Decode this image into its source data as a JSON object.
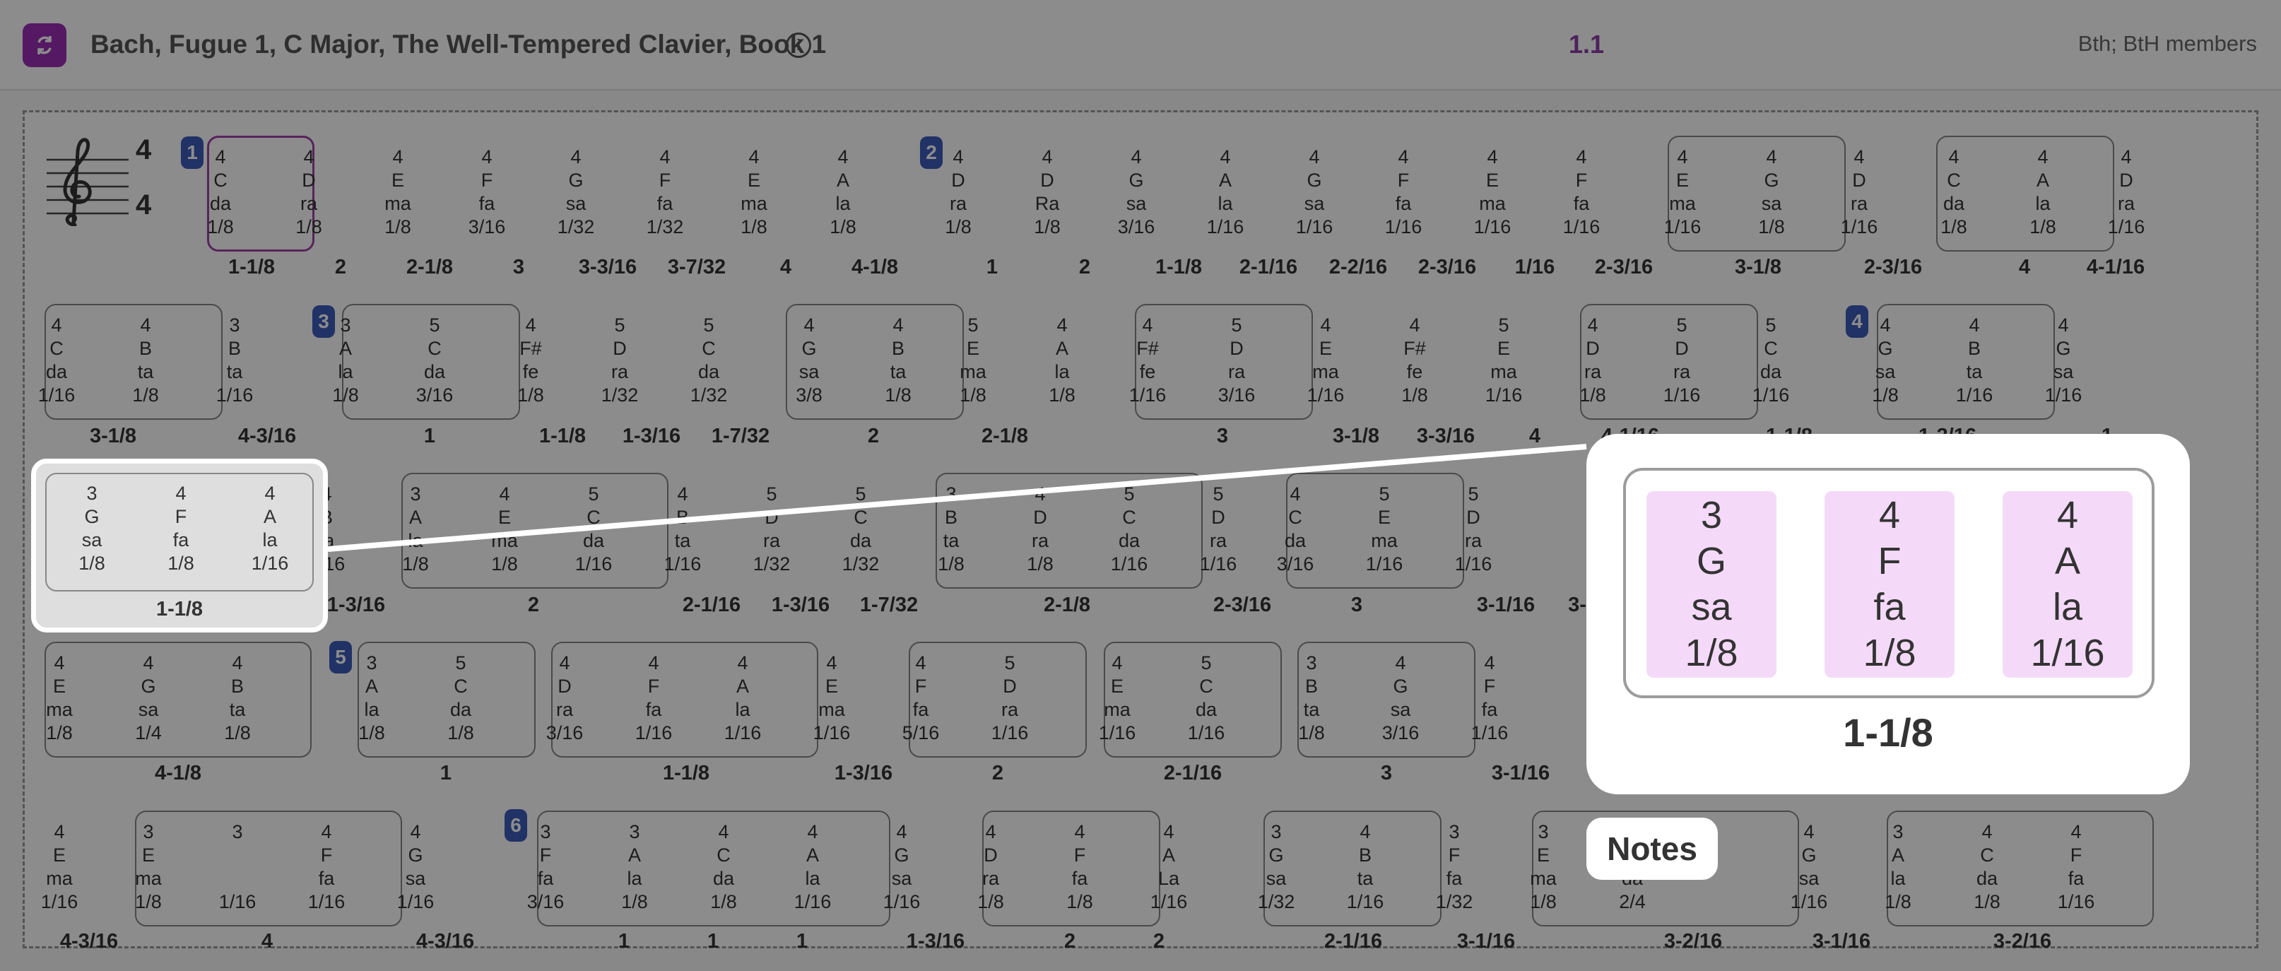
{
  "header": {
    "title": "Bach, Fugue 1, C Major, The Well-Tempered Clavier, Book 1",
    "version": "1.1",
    "members": "Bth; BtH members",
    "app_icon": "refresh-icon",
    "info_icon": "info-icon",
    "info_glyph": "i",
    "icon_color": "#9b2fb4",
    "accent": "#8b3fa8"
  },
  "time_signature": {
    "top": "4",
    "bottom": "4",
    "clef": "treble-clef-icon"
  },
  "measures": [
    "1",
    "2",
    "3",
    "4",
    "5",
    "6"
  ],
  "rows": [
    {
      "notes": [
        [
          "4",
          "C",
          "da",
          "1/8"
        ],
        [
          "4",
          "D",
          "ra",
          "1/8"
        ],
        [
          "4",
          "E",
          "ma",
          "1/8"
        ],
        [
          "4",
          "F",
          "fa",
          "3/16"
        ],
        [
          "4",
          "G",
          "sa",
          "1/32"
        ],
        [
          "4",
          "F",
          "fa",
          "1/32"
        ],
        [
          "4",
          "E",
          "ma",
          "1/8"
        ],
        [
          "4",
          "A",
          "la",
          "1/8"
        ],
        [
          "4",
          "D",
          "ra",
          "1/8"
        ],
        [
          "4",
          "D",
          "Ra",
          "1/8"
        ],
        [
          "4",
          "G",
          "sa",
          "3/16"
        ],
        [
          "4",
          "A",
          "la",
          "1/16"
        ],
        [
          "4",
          "G",
          "sa",
          "1/16"
        ],
        [
          "4",
          "F",
          "fa",
          "1/16"
        ],
        [
          "4",
          "E",
          "ma",
          "1/16"
        ],
        [
          "4",
          "F",
          "fa",
          "1/16"
        ],
        [
          "4",
          "E",
          "ma",
          "1/16"
        ],
        [
          "4",
          "G",
          "sa",
          "1/8"
        ],
        [
          "4",
          "D",
          "ra",
          "1/16"
        ],
        [
          "4",
          "C",
          "da",
          "1/8"
        ],
        [
          "4",
          "A",
          "la",
          "1/8"
        ],
        [
          "4",
          "D",
          "ra",
          "1/16"
        ]
      ],
      "labels": [
        "1-1/8",
        "2",
        "2-1/8",
        "3",
        "3-3/16",
        "3-7/32",
        "4",
        "4-1/8",
        "1",
        "2",
        "1-1/8",
        "2-1/16",
        "2-2/16",
        "2-3/16",
        "1/16",
        "2-3/16",
        "3-1/8",
        "2-3/16",
        "4",
        "4-1/16"
      ]
    },
    {
      "notes": [
        [
          "4",
          "C",
          "da",
          "1/16"
        ],
        [
          "4",
          "B",
          "ta",
          "1/8"
        ],
        [
          "3",
          "B",
          "ta",
          "1/16"
        ],
        [
          "3",
          "A",
          "la",
          "1/8"
        ],
        [
          "5",
          "C",
          "da",
          "3/16"
        ],
        [
          "4",
          "F#",
          "fe",
          "1/8"
        ],
        [
          "5",
          "D",
          "ra",
          "1/32"
        ],
        [
          "5",
          "C",
          "da",
          "1/32"
        ],
        [
          "4",
          "G",
          "sa",
          "3/8"
        ],
        [
          "4",
          "B",
          "ta",
          "1/8"
        ],
        [
          "5",
          "E",
          "ma",
          "1/8"
        ],
        [
          "4",
          "A",
          "la",
          "1/8"
        ],
        [
          "4",
          "F#",
          "fe",
          "1/16"
        ],
        [
          "5",
          "D",
          "ra",
          "3/16"
        ],
        [
          "4",
          "E",
          "ma",
          "1/16"
        ],
        [
          "4",
          "F#",
          "fe",
          "1/8"
        ],
        [
          "5",
          "E",
          "ma",
          "1/16"
        ],
        [
          "4",
          "D",
          "ra",
          "1/8"
        ],
        [
          "5",
          "D",
          "ra",
          "1/16"
        ],
        [
          "5",
          "C",
          "da",
          "1/16"
        ],
        [
          "4",
          "G",
          "sa",
          "1/8"
        ],
        [
          "4",
          "B",
          "ta",
          "1/16"
        ],
        [
          "4",
          "G",
          "sa",
          "1/16"
        ]
      ],
      "labels": [
        "3-1/8",
        "4-3/16",
        "1",
        "1-1/8",
        "1-3/16",
        "1-7/32",
        "2",
        "2-1/8",
        "3",
        "3-1/8",
        "3-3/16",
        "4",
        "4-1/16",
        "1-1/8",
        "1-3/16",
        "1",
        "1-1/16"
      ]
    },
    {
      "notes": [
        [
          "3",
          "G",
          "sa",
          "1/8"
        ],
        [
          "4",
          "F",
          "fa",
          "1/8"
        ],
        [
          "4",
          "A",
          "la",
          "1/16"
        ],
        [
          "4",
          "B",
          "ta",
          "1/16"
        ],
        [
          "3",
          "A",
          "la",
          "1/8"
        ],
        [
          "4",
          "E",
          "ma",
          "1/8"
        ],
        [
          "5",
          "C",
          "da",
          "1/16"
        ],
        [
          "4",
          "B",
          "ta",
          "1/16"
        ],
        [
          "5",
          "D",
          "ra",
          "1/32"
        ],
        [
          "5",
          "C",
          "da",
          "1/32"
        ],
        [
          "3",
          "B",
          "ta",
          "1/8"
        ],
        [
          "4",
          "D",
          "ra",
          "1/8"
        ],
        [
          "5",
          "C",
          "da",
          "1/16"
        ],
        [
          "5",
          "D",
          "ra",
          "1/16"
        ],
        [
          "4",
          "C",
          "da",
          "3/16"
        ],
        [
          "5",
          "E",
          "ma",
          "1/16"
        ],
        [
          "5",
          "D",
          "ra",
          "1/16"
        ]
      ],
      "labels": [
        "1-1/8",
        "1-3/16",
        "2",
        "2-1/16",
        "1-3/16",
        "1-7/32",
        "2-1/8",
        "2-3/16",
        "3",
        "3-1/16",
        "3-"
      ]
    },
    {
      "notes": [
        [
          "4",
          "E",
          "ma",
          "1/8"
        ],
        [
          "4",
          "G",
          "sa",
          "1/4"
        ],
        [
          "4",
          "B",
          "ta",
          "1/8"
        ],
        [
          "3",
          "A",
          "la",
          "1/8"
        ],
        [
          "5",
          "C",
          "da",
          "1/8"
        ],
        [
          "4",
          "D",
          "ra",
          "3/16"
        ],
        [
          "4",
          "F",
          "fa",
          "1/16"
        ],
        [
          "4",
          "A",
          "la",
          "1/16"
        ],
        [
          "4",
          "E",
          "ma",
          "1/16"
        ],
        [
          "4",
          "F",
          "fa",
          "5/16"
        ],
        [
          "5",
          "D",
          "ra",
          "1/16"
        ],
        [
          "4",
          "E",
          "ma",
          "1/16"
        ],
        [
          "5",
          "C",
          "da",
          "1/16"
        ],
        [
          "3",
          "B",
          "ta",
          "1/8"
        ],
        [
          "4",
          "G",
          "sa",
          "3/16"
        ],
        [
          "4",
          "F",
          "fa",
          "1/16"
        ]
      ],
      "labels": [
        "4-1/8",
        "1",
        "1-1/8",
        "1-3/16",
        "2",
        "2-1/16",
        "3",
        "3-1/16"
      ]
    },
    {
      "notes": [
        [
          "4",
          "E",
          "ma",
          "1/16"
        ],
        [
          "3",
          "E",
          "ma",
          "1/8"
        ],
        [
          "3",
          "",
          "",
          "1/16"
        ],
        [
          "4",
          "F",
          "fa",
          "1/16"
        ],
        [
          "4",
          "G",
          "sa",
          "1/16"
        ],
        [
          "3",
          "F",
          "fa",
          "3/16"
        ],
        [
          "3",
          "A",
          "la",
          "1/8"
        ],
        [
          "4",
          "C",
          "da",
          "1/8"
        ],
        [
          "4",
          "A",
          "la",
          "1/16"
        ],
        [
          "4",
          "G",
          "sa",
          "1/16"
        ],
        [
          "4",
          "D",
          "ra",
          "1/8"
        ],
        [
          "4",
          "F",
          "fa",
          "1/8"
        ],
        [
          "4",
          "A",
          "La",
          "1/16"
        ],
        [
          "3",
          "G",
          "sa",
          "1/32"
        ],
        [
          "4",
          "B",
          "ta",
          "1/16"
        ],
        [
          "3",
          "F",
          "fa",
          "1/32"
        ],
        [
          "3",
          "E",
          "ma",
          "1/8"
        ],
        [
          "5",
          "C",
          "da",
          "2/4"
        ],
        [
          "4",
          "G",
          "sa",
          "1/16"
        ],
        [
          "3",
          "A",
          "la",
          "1/8"
        ],
        [
          "4",
          "C",
          "da",
          "1/8"
        ],
        [
          "4",
          "F",
          "fa",
          "1/16"
        ]
      ],
      "labels": [
        "4-3/16",
        "4",
        "4-3/16",
        "1",
        "1",
        "1",
        "1-3/16",
        "2",
        "2",
        "2-1/16",
        "3-1/16",
        "3-2/16",
        "3-1/16",
        "3-2/16"
      ]
    }
  ],
  "selection": {
    "notes": [
      [
        "3",
        "G",
        "sa",
        "1/8"
      ],
      [
        "4",
        "F",
        "fa",
        "1/8"
      ],
      [
        "4",
        "A",
        "la",
        "1/16"
      ]
    ],
    "label": "1-1/8"
  },
  "zoom": {
    "notes": [
      [
        "3",
        "G",
        "sa",
        "1/8"
      ],
      [
        "4",
        "F",
        "fa",
        "1/8"
      ],
      [
        "4",
        "A",
        "la",
        "1/16"
      ]
    ],
    "label": "1-1/8",
    "highlight_color": "#f4daf8"
  },
  "callout": {
    "text": "Notes"
  }
}
